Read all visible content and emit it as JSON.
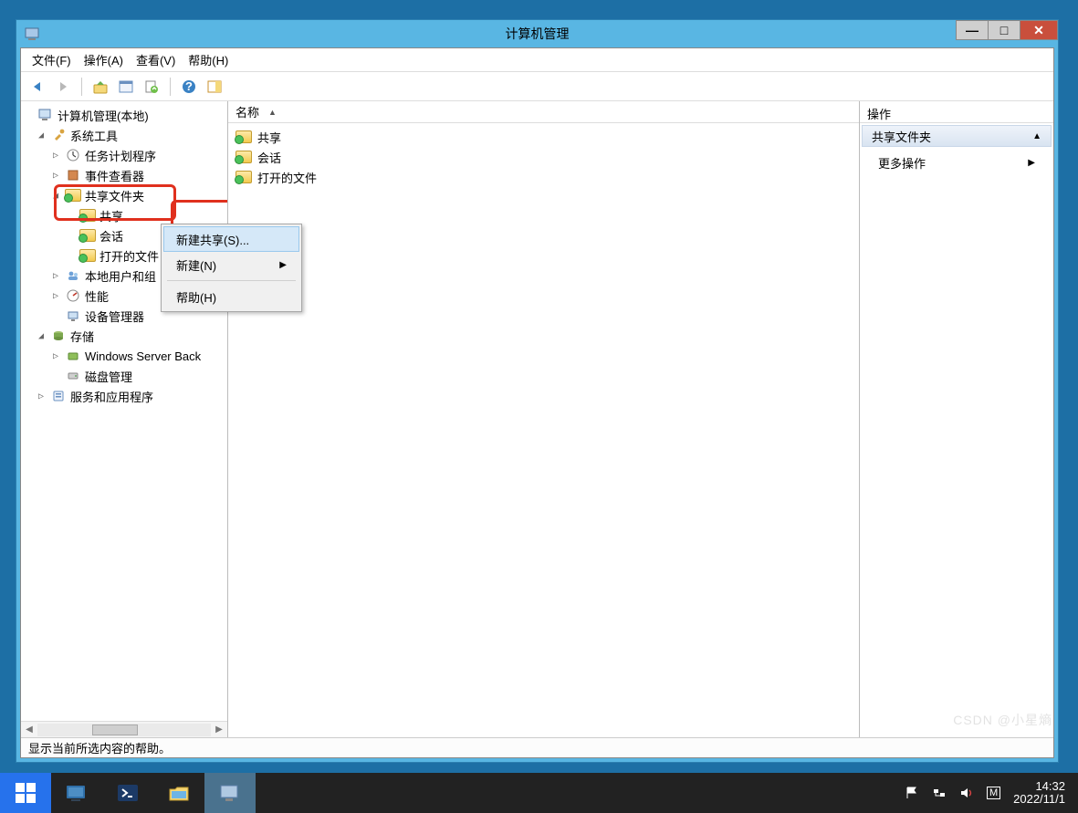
{
  "window": {
    "title": "计算机管理",
    "minimize": "—",
    "maximize": "□",
    "close": "✕"
  },
  "menubar": {
    "file": "文件(F)",
    "action": "操作(A)",
    "view": "查看(V)",
    "help": "帮助(H)"
  },
  "tree": {
    "root": "计算机管理(本地)",
    "system_tools": "系统工具",
    "task_scheduler": "任务计划程序",
    "event_viewer": "事件查看器",
    "shared_folders": "共享文件夹",
    "shares": "共享",
    "sessions": "会话",
    "open_files": "打开的文件",
    "local_users": "本地用户和组",
    "performance": "性能",
    "device_manager": "设备管理器",
    "storage": "存储",
    "wsb": "Windows Server Back",
    "disk_mgmt": "磁盘管理",
    "services_apps": "服务和应用程序"
  },
  "center": {
    "col_name": "名称",
    "items": {
      "shares": "共享",
      "sessions": "会话",
      "open_files": "打开的文件"
    }
  },
  "context_menu": {
    "new_share": "新建共享(S)...",
    "new": "新建(N)",
    "help": "帮助(H)"
  },
  "actions": {
    "title": "操作",
    "section": "共享文件夹",
    "more": "更多操作"
  },
  "statusbar": "显示当前所选内容的帮助。",
  "taskbar": {
    "time": "14:32",
    "date": "2022/11/1"
  },
  "watermark": "CSDN @小星熵"
}
